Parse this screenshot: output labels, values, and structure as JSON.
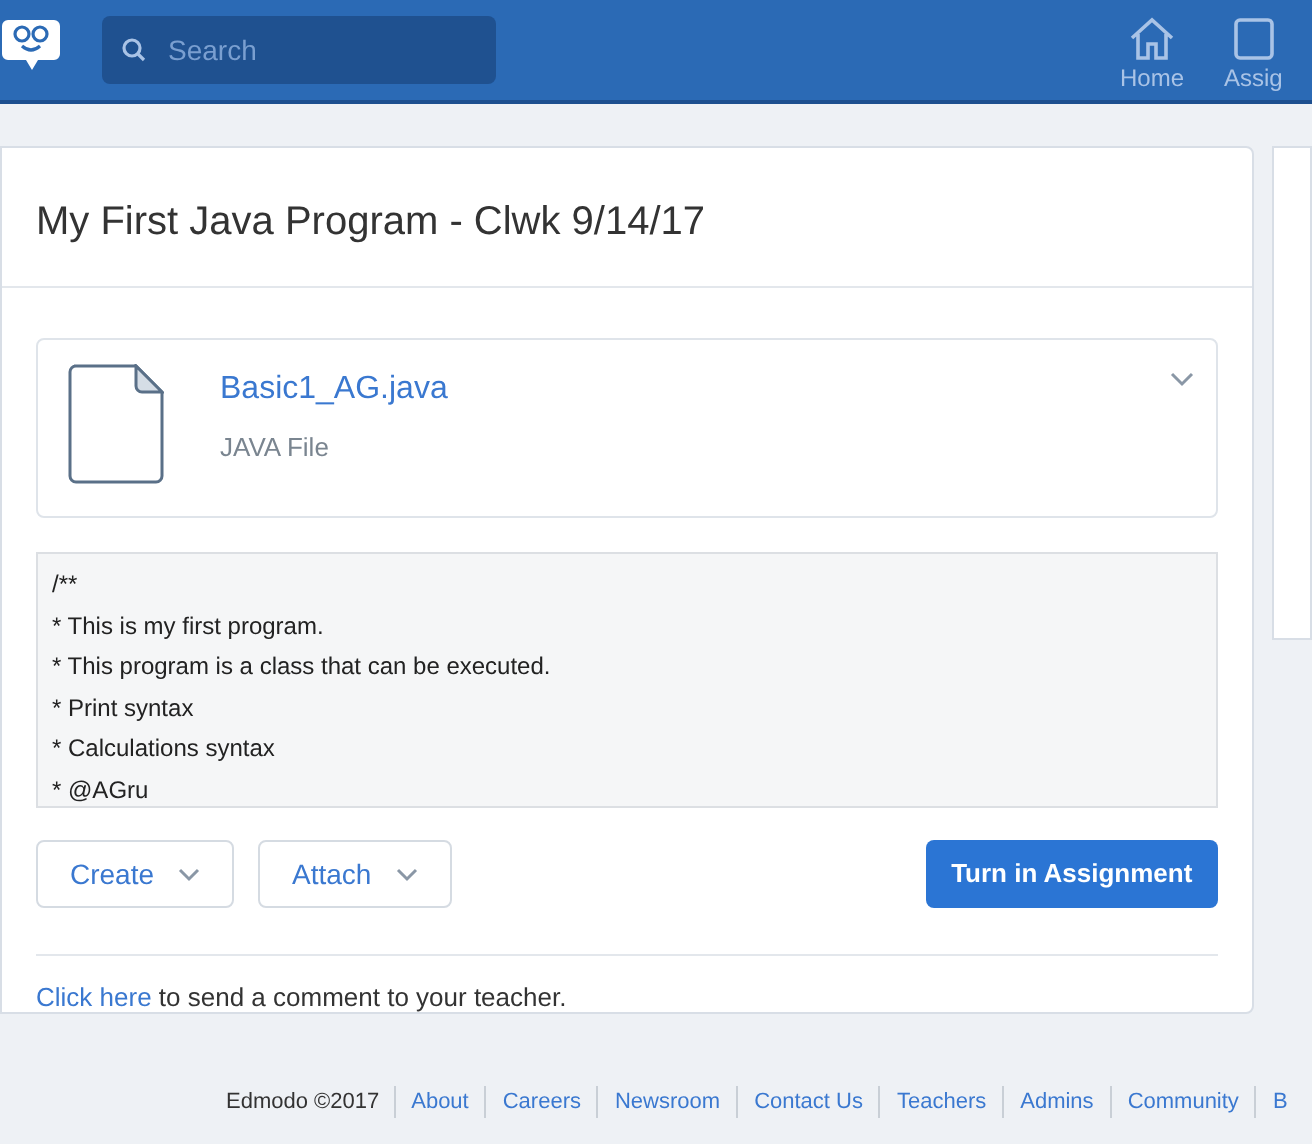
{
  "navbar": {
    "search": {
      "placeholder": "Search"
    },
    "items": [
      {
        "label": "Home"
      },
      {
        "label": "Assig"
      }
    ]
  },
  "assignment": {
    "title": "My First Java Program - Clwk 9/14/17",
    "attachment": {
      "name": "Basic1_AG.java",
      "type": "JAVA File",
      "expanded": false
    },
    "preview_lines": [
      "/**",
      "* This is my first program.",
      "* This program is a class that can be executed.",
      "* Print syntax",
      "* Calculations syntax",
      "* @AGru"
    ],
    "buttons": [
      {
        "label": "Create"
      },
      {
        "label": "Attach"
      }
    ],
    "submit": "Turn in Assignment",
    "comment": {
      "link": "Click here",
      "text": "to send a comment to your teacher."
    }
  },
  "footer": {
    "copyright": "Edmodo ©2017",
    "links": [
      "About",
      "Careers",
      "Newsroom",
      "Contact Us",
      "Teachers",
      "Admins",
      "Community",
      "B"
    ]
  }
}
